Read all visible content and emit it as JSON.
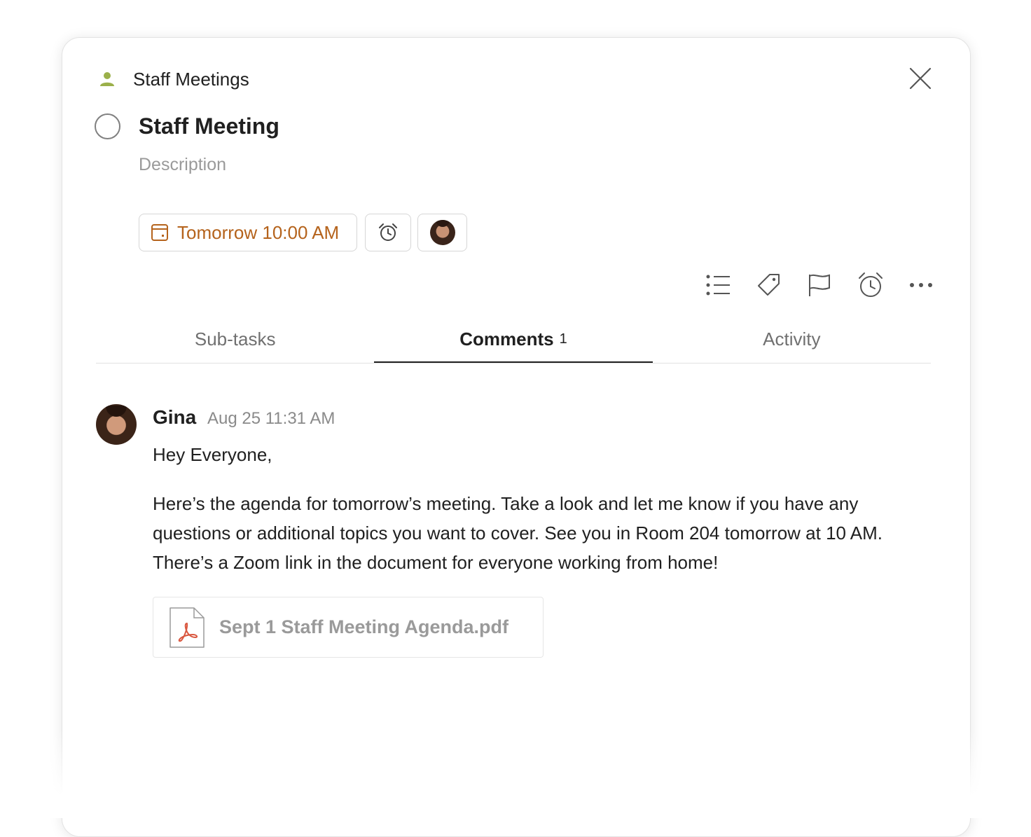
{
  "project": {
    "name": "Staff Meetings",
    "icon": "person-icon",
    "icon_color": "#9bb04a"
  },
  "task": {
    "title": "Staff Meeting",
    "description_placeholder": "Description"
  },
  "chips": {
    "due_date": "Tomorrow 10:00 AM",
    "due_color": "#b5631c",
    "alarm_icon": "alarm-clock-icon",
    "assignee_icon": "avatar"
  },
  "toolbar": {
    "icons": [
      "sub-tasks-list-icon",
      "label-tag-icon",
      "priority-flag-icon",
      "reminder-alarm-icon",
      "more-options-icon"
    ]
  },
  "tabs": [
    {
      "label": "Sub-tasks",
      "active": false
    },
    {
      "label": "Comments",
      "count": "1",
      "active": true
    },
    {
      "label": "Activity",
      "active": false
    }
  ],
  "comment": {
    "author": "Gina",
    "timestamp": "Aug 25 11:31 AM",
    "greeting": "Hey Everyone,",
    "body": "Here’s the agenda for tomorrow’s meeting. Take a look and let me know if you have any questions or additional topics you want to cover. See you in Room 204 tomorrow at 10 AM. There’s a Zoom link in the document for everyone working from home!",
    "attachment": {
      "name": "Sept 1 Staff Meeting Agenda.pdf",
      "icon": "pdf-file-icon",
      "accent_color": "#d9573f"
    }
  }
}
